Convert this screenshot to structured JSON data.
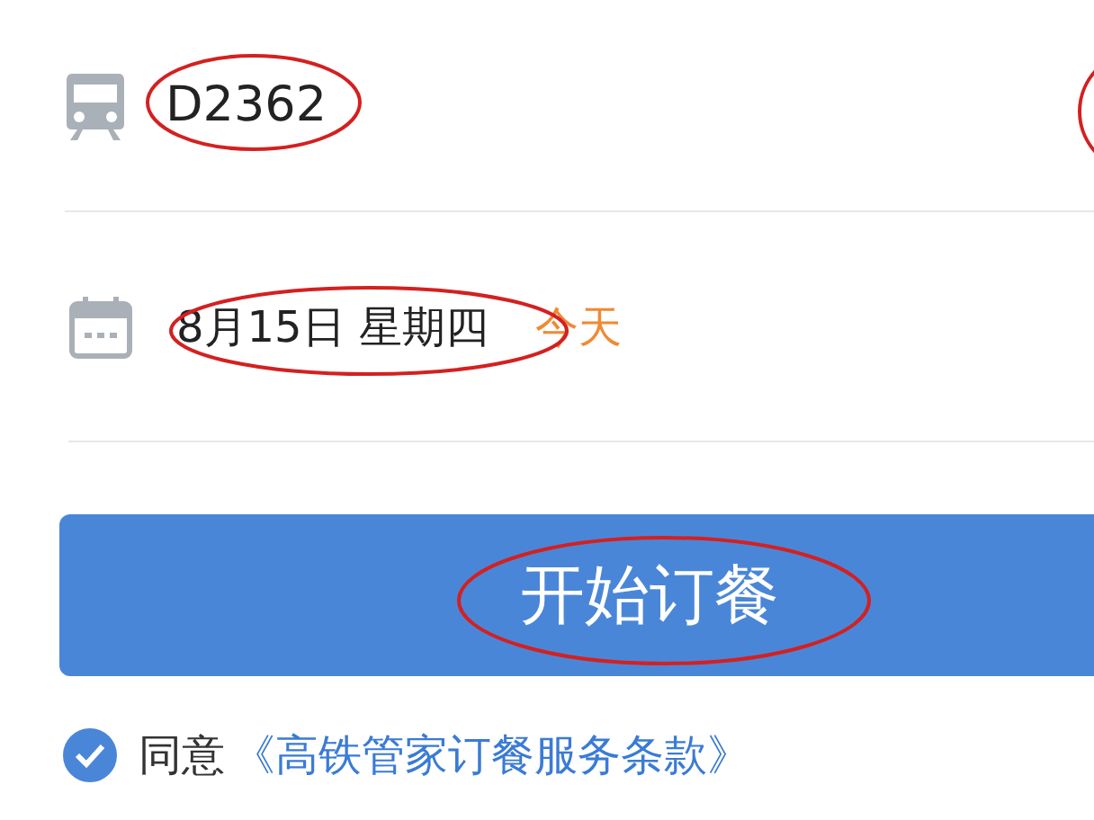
{
  "train_row": {
    "value": "D2362"
  },
  "date_row": {
    "value": "8月15日 星期四",
    "badge": "今天"
  },
  "order_button": {
    "label": "开始订餐"
  },
  "agreement": {
    "checked": true,
    "prefix": "同意",
    "link": "《高铁管家订餐服务条款》"
  }
}
